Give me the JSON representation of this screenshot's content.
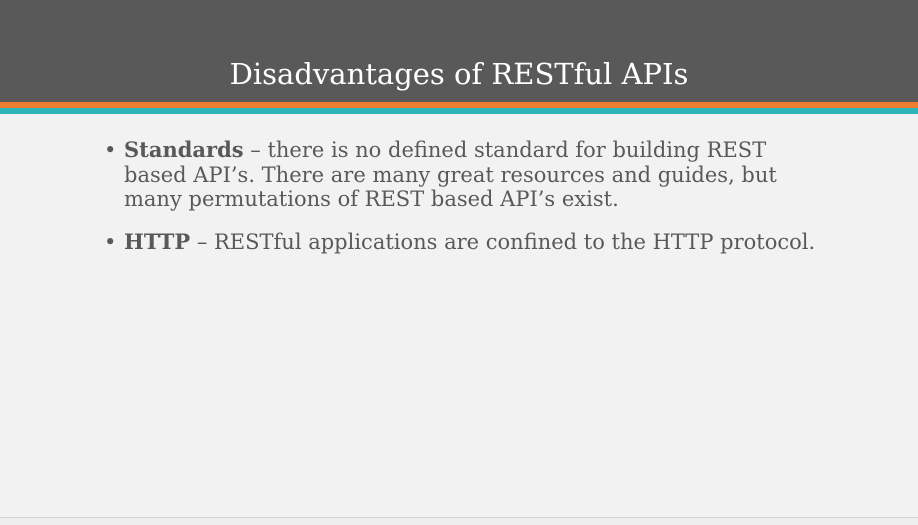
{
  "slide": {
    "title": "Disadvantages of RESTful APIs",
    "bullet_char": "•",
    "bullets": [
      {
        "term": "Standards",
        "text": " – there is no defined standard for building REST based API’s. There are many great resources and guides, but many permutations of REST based API’s exist."
      },
      {
        "term": "HTTP",
        "text": " – RESTful applications are confined to the HTTP protocol."
      }
    ]
  },
  "colors": {
    "title_bar": "#595959",
    "accent_orange": "#ed7d31",
    "accent_teal": "#2db5b7",
    "background": "#f2f2f2",
    "body_text": "#595959"
  }
}
